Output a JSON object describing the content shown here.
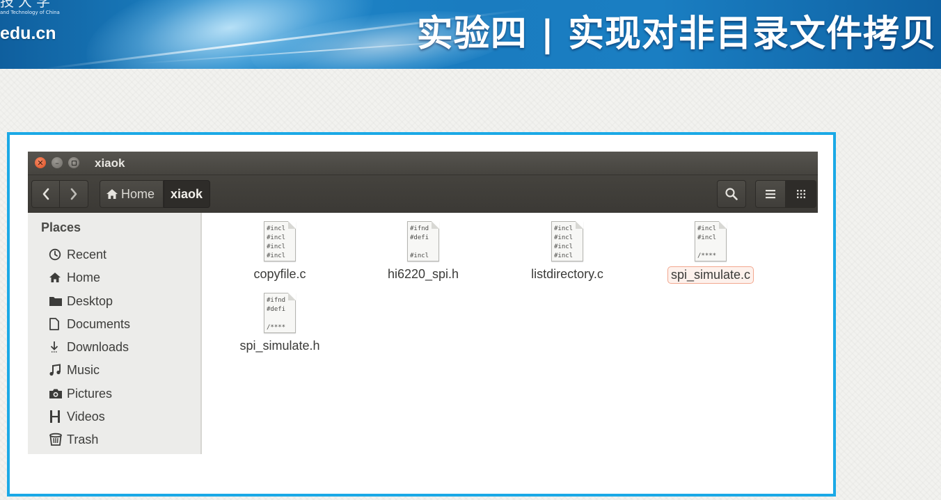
{
  "banner": {
    "logo_text": "技大学",
    "logo_sub": "and Technology of China",
    "logo_url": "edu.cn",
    "title": "实验四 | 实现对非目录文件拷贝"
  },
  "window": {
    "title": "xiaok",
    "breadcrumb": {
      "home": "Home",
      "current": "xiaok"
    }
  },
  "sidebar": {
    "heading": "Places",
    "items": [
      {
        "label": "Recent",
        "icon": "clock-icon"
      },
      {
        "label": "Home",
        "icon": "home-icon"
      },
      {
        "label": "Desktop",
        "icon": "folder-icon"
      },
      {
        "label": "Documents",
        "icon": "document-icon"
      },
      {
        "label": "Downloads",
        "icon": "download-icon"
      },
      {
        "label": "Music",
        "icon": "music-icon"
      },
      {
        "label": "Pictures",
        "icon": "camera-icon"
      },
      {
        "label": "Videos",
        "icon": "film-icon"
      },
      {
        "label": "Trash",
        "icon": "trash-icon"
      }
    ]
  },
  "files": [
    {
      "name": "copyfile.c",
      "preview": [
        "#incl",
        "#incl",
        "#incl",
        "#incl"
      ],
      "selected": false
    },
    {
      "name": "hi6220_spi.h",
      "preview": [
        "#ifnd",
        "#defi",
        "",
        "#incl"
      ],
      "selected": false
    },
    {
      "name": "listdirectory.c",
      "preview": [
        "#incl",
        "#incl",
        "#incl",
        "#incl"
      ],
      "selected": false
    },
    {
      "name": "spi_simulate.c",
      "preview": [
        "#incl",
        "#incl",
        "",
        "/****"
      ],
      "selected": true
    },
    {
      "name": "spi_simulate.h",
      "preview": [
        "#ifnd",
        "#defi",
        "",
        "/****"
      ],
      "selected": false
    }
  ]
}
